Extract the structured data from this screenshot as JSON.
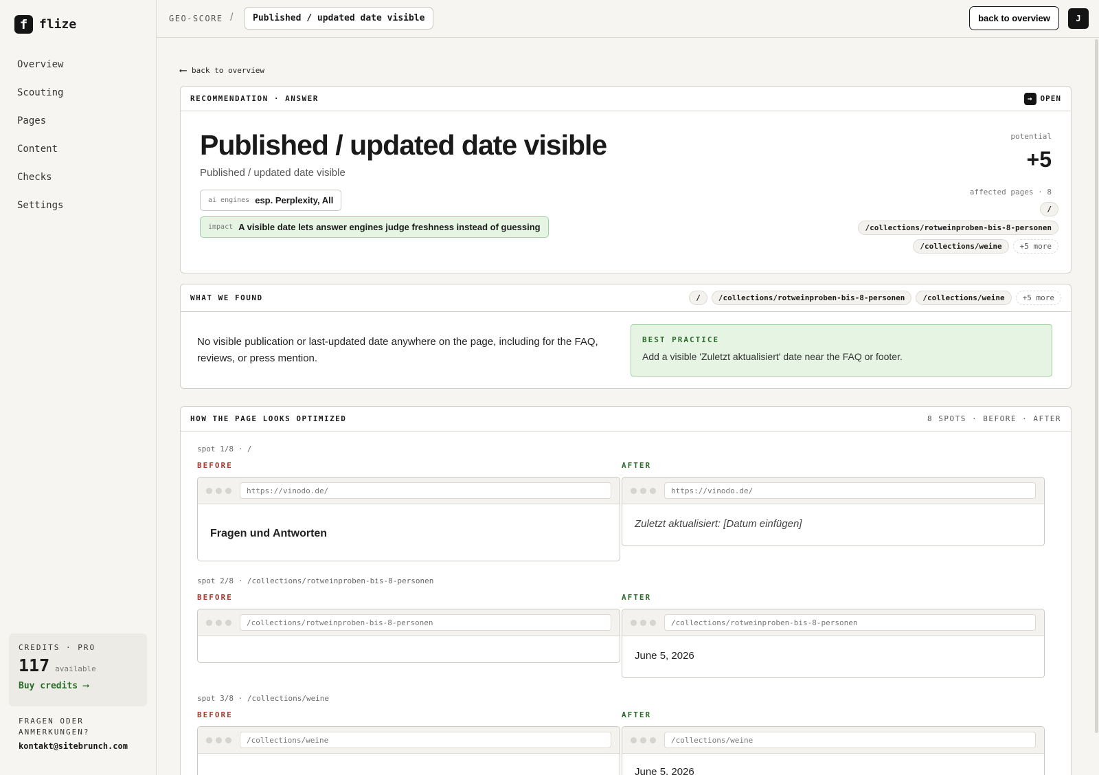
{
  "app": {
    "logo_letter": "f",
    "name": "flize"
  },
  "sidebar": {
    "nav": [
      "Overview",
      "Scouting",
      "Pages",
      "Content",
      "Checks",
      "Settings"
    ],
    "credits": {
      "label": "CREDITS · PRO",
      "value": "117",
      "available": "available",
      "buy": "Buy credits",
      "buy_arrow": "⟶"
    },
    "contact": {
      "question": "FRAGEN ODER ANMERKUNGEN?",
      "email": "kontakt@sitebrunch.com"
    }
  },
  "topbar": {
    "root": "GEO-SCORE",
    "sep": "/",
    "current": "Published / updated date visible",
    "back": "back to overview",
    "avatar": "J"
  },
  "back_link": {
    "arrow": "⟵",
    "label": "back to overview"
  },
  "recommendation": {
    "header": "RECOMMENDATION · ANSWER",
    "status": "OPEN",
    "title": "Published / updated date visible",
    "subtitle": "Published / updated date visible",
    "engines_key": "ai engines",
    "engines_val": "esp. Perplexity, All",
    "impact_key": "impact",
    "impact_val": "A visible date lets answer engines judge freshness instead of guessing",
    "potential_label": "potential",
    "potential_value": "+5",
    "affected_label": "affected pages · 8",
    "pages": [
      "/",
      "/collections/rotweinproben-bis-8-personen",
      "/collections/weine"
    ],
    "more": "+5 more"
  },
  "found": {
    "header": "WHAT WE FOUND",
    "pages": [
      "/",
      "/collections/rotweinproben-bis-8-personen",
      "/collections/weine"
    ],
    "more": "+5 more",
    "text": "No visible publication or last-updated date anywhere on the page, including for the FAQ, reviews, or press mention.",
    "best_label": "BEST PRACTICE",
    "best_text": "Add a visible 'Zuletzt aktualisiert' date near the FAQ or footer."
  },
  "optimized": {
    "header": "HOW THE PAGE LOOKS OPTIMIZED",
    "meta": "8 SPOTS · BEFORE · AFTER",
    "before_label": "BEFORE",
    "after_label": "AFTER",
    "spots": [
      {
        "label": "spot 1/8 · /",
        "before_url": "https://vinodo.de/",
        "before_text": "Fragen und Antworten",
        "after_url": "https://vinodo.de/",
        "after_text": "Zuletzt aktualisiert: [Datum einfügen]"
      },
      {
        "label": "spot 2/8 · /collections/rotweinproben-bis-8-personen",
        "before_url": "/collections/rotweinproben-bis-8-personen",
        "before_text": "",
        "after_url": "/collections/rotweinproben-bis-8-personen",
        "after_text": "June 5, 2026"
      },
      {
        "label": "spot 3/8 · /collections/weine",
        "before_url": "/collections/weine",
        "before_text": "",
        "after_url": "/collections/weine",
        "after_text": "June 5, 2026"
      }
    ]
  }
}
